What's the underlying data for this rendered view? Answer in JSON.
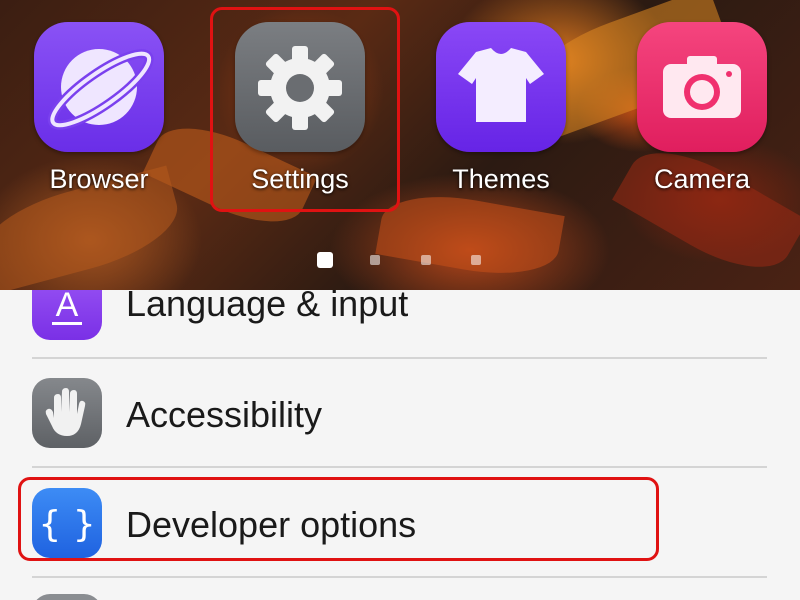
{
  "home_screen": {
    "apps": [
      {
        "label": "Browser",
        "icon": "browser-icon",
        "color": "#7e3ff2"
      },
      {
        "label": "Settings",
        "icon": "gear-icon",
        "color": "#6b6e72"
      },
      {
        "label": "Themes",
        "icon": "tshirt-icon",
        "color": "#7a2ff0"
      },
      {
        "label": "Camera",
        "icon": "camera-icon",
        "color": "#f0306e"
      }
    ],
    "page_indicator": {
      "pages": 4,
      "current": 1
    }
  },
  "settings_list": {
    "items": [
      {
        "label": "Language & input",
        "icon": "language-icon",
        "color": "#8a3ff0"
      },
      {
        "label": "Accessibility",
        "icon": "hand-icon",
        "color": "#6f7276"
      },
      {
        "label": "Developer options",
        "icon": "braces-icon",
        "color": "#2f7ef0"
      }
    ]
  },
  "highlight_color": "#e01212"
}
